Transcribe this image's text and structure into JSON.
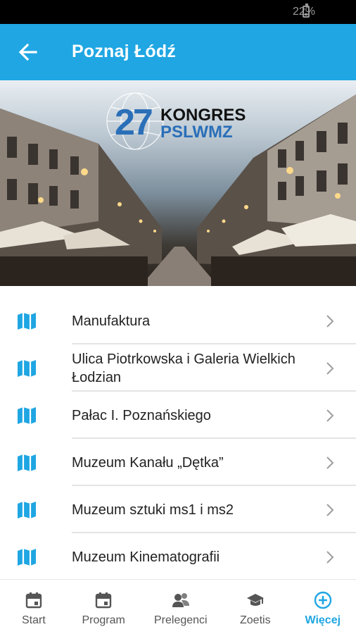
{
  "status_bar": {
    "battery": "22%"
  },
  "app_bar": {
    "title": "Poznaj Łódź"
  },
  "hero": {
    "logo_number": "27",
    "logo_line1": "KONGRES",
    "logo_line2": "PSLWMZ"
  },
  "places": [
    {
      "label": "Manufaktura"
    },
    {
      "label": "Ulica Piotrkowska i Galeria Wielkich Łodzian"
    },
    {
      "label": "Pałac I. Poznańskiego"
    },
    {
      "label": "Muzeum Kanału „Dętka”"
    },
    {
      "label": "Muzeum sztuki ms1 i ms2"
    },
    {
      "label": "Muzeum Kinematografii"
    }
  ],
  "bottom_nav": [
    {
      "label": "Start",
      "icon": "calendar-icon",
      "active": false
    },
    {
      "label": "Program",
      "icon": "calendar-icon",
      "active": false
    },
    {
      "label": "Prelegenci",
      "icon": "people-icon",
      "active": false
    },
    {
      "label": "Zoetis",
      "icon": "graduation-cap-icon",
      "active": false
    },
    {
      "label": "Więcej",
      "icon": "plus-circle-icon",
      "active": true
    }
  ],
  "colors": {
    "accent": "#1fa6e3",
    "icon_grey": "#555555",
    "chevron": "#9e9e9e"
  }
}
